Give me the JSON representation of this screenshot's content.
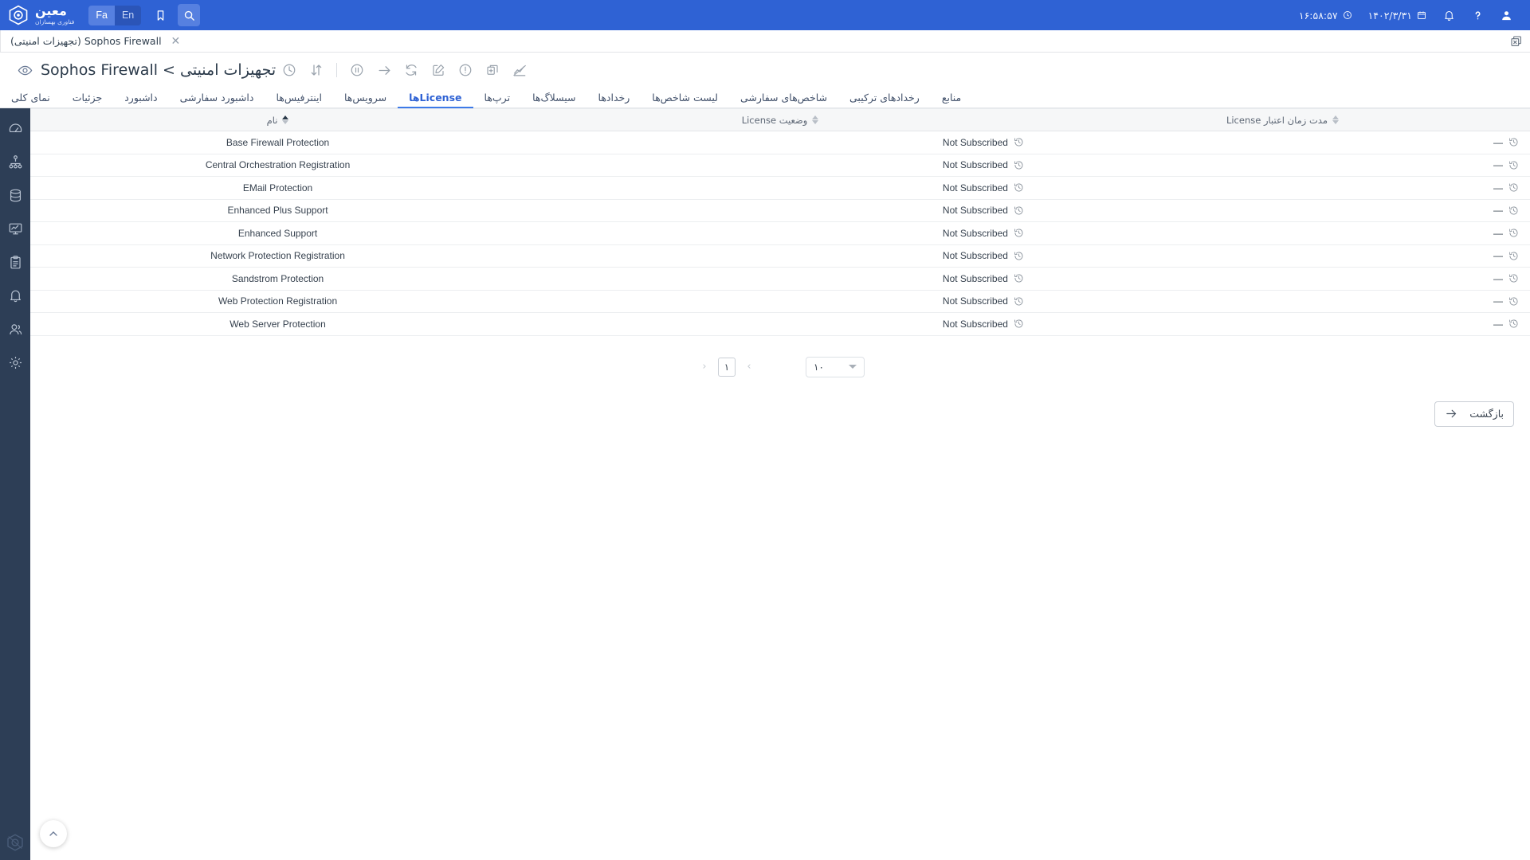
{
  "topbar": {
    "icons": [
      {
        "name": "user-icon",
        "glyph": "user"
      },
      {
        "name": "help-icon",
        "glyph": "question"
      },
      {
        "name": "notification-bell-icon",
        "glyph": "bell"
      }
    ],
    "date": "۱۴۰۲/۳/۳۱",
    "time": "۱۶:۵۸:۵۷",
    "search_label": "search-icon",
    "bookmark_label": "bookmark-icon",
    "lang_en": "En",
    "lang_fa": "Fa",
    "brand_name": "معین",
    "brand_sub": "فناوری بهسازان"
  },
  "tabstrip": {
    "close_all_title": "close-all-tabs",
    "tabs": [
      {
        "label": "Sophos Firewall (تجهیزات امنیتی)",
        "close": "✕",
        "active": true
      }
    ]
  },
  "page_header": {
    "title": "تجهیزات امنیتی > Sophos Firewall",
    "toolbar": [
      {
        "name": "chart-disabled-icon"
      },
      {
        "name": "duplicate-icon"
      },
      {
        "name": "alert-circle-icon"
      },
      {
        "name": "edit-icon"
      },
      {
        "name": "refresh-icon"
      },
      {
        "name": "arrow-right-icon"
      },
      {
        "name": "pause-circle-icon"
      },
      {
        "name": "separator"
      },
      {
        "name": "sort-icon"
      },
      {
        "name": "clock-icon"
      }
    ]
  },
  "nav_tabs": [
    {
      "label": "نمای کلی",
      "active": false
    },
    {
      "label": "جزئیات",
      "active": false
    },
    {
      "label": "داشبورد",
      "active": false
    },
    {
      "label": "داشبورد سفارشی",
      "active": false
    },
    {
      "label": "اینترفیس‌ها",
      "active": false
    },
    {
      "label": "سرویس‌ها",
      "active": false
    },
    {
      "label": "License‌ها",
      "active": true
    },
    {
      "label": "ترپ‌ها",
      "active": false
    },
    {
      "label": "سیسلاگ‌ها",
      "active": false
    },
    {
      "label": "رخدادها",
      "active": false
    },
    {
      "label": "لیست شاخص‌ها",
      "active": false
    },
    {
      "label": "شاخص‌های سفارشی",
      "active": false
    },
    {
      "label": "رخدادهای ترکیبی",
      "active": false
    },
    {
      "label": "منابع",
      "active": false
    }
  ],
  "table": {
    "columns": [
      {
        "key": "duration",
        "label": "مدت زمان اعتبار License",
        "sort": "none"
      },
      {
        "key": "status",
        "label": "وضعیت License",
        "sort": "none"
      },
      {
        "key": "name",
        "label": "نام",
        "sort": "asc"
      }
    ],
    "rows": [
      {
        "name": "Base Firewall Protection",
        "status": "Not Subscribed",
        "duration": "—"
      },
      {
        "name": "Central Orchestration Registration",
        "status": "Not Subscribed",
        "duration": "—"
      },
      {
        "name": "EMail Protection",
        "status": "Not Subscribed",
        "duration": "—"
      },
      {
        "name": "Enhanced Plus Support",
        "status": "Not Subscribed",
        "duration": "—"
      },
      {
        "name": "Enhanced Support",
        "status": "Not Subscribed",
        "duration": "—"
      },
      {
        "name": "Network Protection Registration",
        "status": "Not Subscribed",
        "duration": "—"
      },
      {
        "name": "Sandstrom Protection",
        "status": "Not Subscribed",
        "duration": "—"
      },
      {
        "name": "Web Protection Registration",
        "status": "Not Subscribed",
        "duration": "—"
      },
      {
        "name": "Web Server Protection",
        "status": "Not Subscribed",
        "duration": "—"
      }
    ]
  },
  "pagination": {
    "prev": "‹",
    "next": "›",
    "current_page": "۱",
    "page_size": "۱۰"
  },
  "back_button": {
    "label": "بازگشت"
  },
  "rail": {
    "icons": [
      {
        "name": "gauge-icon"
      },
      {
        "name": "hierarchy-icon"
      },
      {
        "name": "database-icon"
      },
      {
        "name": "monitor-chart-icon"
      },
      {
        "name": "clipboard-icon"
      },
      {
        "name": "bell-icon"
      },
      {
        "name": "users-icon"
      },
      {
        "name": "gear-icon"
      }
    ],
    "logo": "shield-logo-icon"
  },
  "scroll_top": {
    "name": "scroll-to-top-button"
  },
  "colors": {
    "topbar_blue": "#2F62D4",
    "rail_navy": "#2d3e56",
    "accent": "#3d7ae8",
    "header_gray": "#f6f7f8"
  }
}
